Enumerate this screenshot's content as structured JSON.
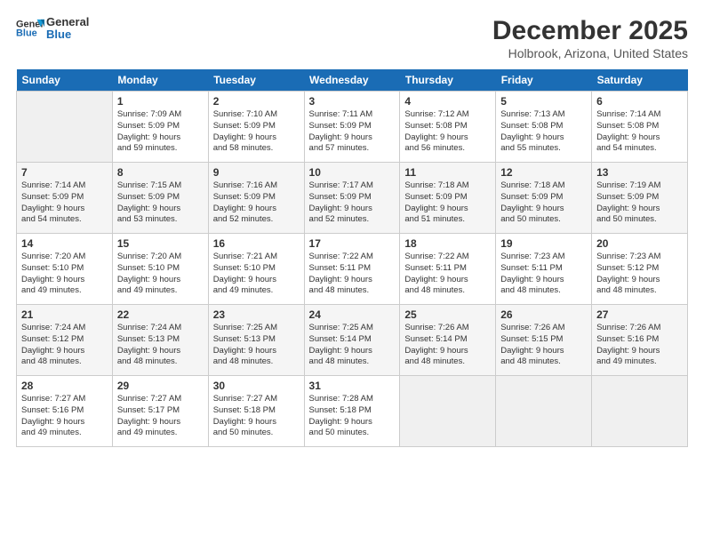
{
  "logo": {
    "line1": "General",
    "line2": "Blue"
  },
  "title": "December 2025",
  "subtitle": "Holbrook, Arizona, United States",
  "days": [
    "Sunday",
    "Monday",
    "Tuesday",
    "Wednesday",
    "Thursday",
    "Friday",
    "Saturday"
  ],
  "weeks": [
    [
      {
        "date": "",
        "info": ""
      },
      {
        "date": "1",
        "info": "Sunrise: 7:09 AM\nSunset: 5:09 PM\nDaylight: 9 hours\nand 59 minutes."
      },
      {
        "date": "2",
        "info": "Sunrise: 7:10 AM\nSunset: 5:09 PM\nDaylight: 9 hours\nand 58 minutes."
      },
      {
        "date": "3",
        "info": "Sunrise: 7:11 AM\nSunset: 5:09 PM\nDaylight: 9 hours\nand 57 minutes."
      },
      {
        "date": "4",
        "info": "Sunrise: 7:12 AM\nSunset: 5:08 PM\nDaylight: 9 hours\nand 56 minutes."
      },
      {
        "date": "5",
        "info": "Sunrise: 7:13 AM\nSunset: 5:08 PM\nDaylight: 9 hours\nand 55 minutes."
      },
      {
        "date": "6",
        "info": "Sunrise: 7:14 AM\nSunset: 5:08 PM\nDaylight: 9 hours\nand 54 minutes."
      }
    ],
    [
      {
        "date": "7",
        "info": "Sunrise: 7:14 AM\nSunset: 5:09 PM\nDaylight: 9 hours\nand 54 minutes."
      },
      {
        "date": "8",
        "info": "Sunrise: 7:15 AM\nSunset: 5:09 PM\nDaylight: 9 hours\nand 53 minutes."
      },
      {
        "date": "9",
        "info": "Sunrise: 7:16 AM\nSunset: 5:09 PM\nDaylight: 9 hours\nand 52 minutes."
      },
      {
        "date": "10",
        "info": "Sunrise: 7:17 AM\nSunset: 5:09 PM\nDaylight: 9 hours\nand 52 minutes."
      },
      {
        "date": "11",
        "info": "Sunrise: 7:18 AM\nSunset: 5:09 PM\nDaylight: 9 hours\nand 51 minutes."
      },
      {
        "date": "12",
        "info": "Sunrise: 7:18 AM\nSunset: 5:09 PM\nDaylight: 9 hours\nand 50 minutes."
      },
      {
        "date": "13",
        "info": "Sunrise: 7:19 AM\nSunset: 5:09 PM\nDaylight: 9 hours\nand 50 minutes."
      }
    ],
    [
      {
        "date": "14",
        "info": "Sunrise: 7:20 AM\nSunset: 5:10 PM\nDaylight: 9 hours\nand 49 minutes."
      },
      {
        "date": "15",
        "info": "Sunrise: 7:20 AM\nSunset: 5:10 PM\nDaylight: 9 hours\nand 49 minutes."
      },
      {
        "date": "16",
        "info": "Sunrise: 7:21 AM\nSunset: 5:10 PM\nDaylight: 9 hours\nand 49 minutes."
      },
      {
        "date": "17",
        "info": "Sunrise: 7:22 AM\nSunset: 5:11 PM\nDaylight: 9 hours\nand 48 minutes."
      },
      {
        "date": "18",
        "info": "Sunrise: 7:22 AM\nSunset: 5:11 PM\nDaylight: 9 hours\nand 48 minutes."
      },
      {
        "date": "19",
        "info": "Sunrise: 7:23 AM\nSunset: 5:11 PM\nDaylight: 9 hours\nand 48 minutes."
      },
      {
        "date": "20",
        "info": "Sunrise: 7:23 AM\nSunset: 5:12 PM\nDaylight: 9 hours\nand 48 minutes."
      }
    ],
    [
      {
        "date": "21",
        "info": "Sunrise: 7:24 AM\nSunset: 5:12 PM\nDaylight: 9 hours\nand 48 minutes."
      },
      {
        "date": "22",
        "info": "Sunrise: 7:24 AM\nSunset: 5:13 PM\nDaylight: 9 hours\nand 48 minutes."
      },
      {
        "date": "23",
        "info": "Sunrise: 7:25 AM\nSunset: 5:13 PM\nDaylight: 9 hours\nand 48 minutes."
      },
      {
        "date": "24",
        "info": "Sunrise: 7:25 AM\nSunset: 5:14 PM\nDaylight: 9 hours\nand 48 minutes."
      },
      {
        "date": "25",
        "info": "Sunrise: 7:26 AM\nSunset: 5:14 PM\nDaylight: 9 hours\nand 48 minutes."
      },
      {
        "date": "26",
        "info": "Sunrise: 7:26 AM\nSunset: 5:15 PM\nDaylight: 9 hours\nand 48 minutes."
      },
      {
        "date": "27",
        "info": "Sunrise: 7:26 AM\nSunset: 5:16 PM\nDaylight: 9 hours\nand 49 minutes."
      }
    ],
    [
      {
        "date": "28",
        "info": "Sunrise: 7:27 AM\nSunset: 5:16 PM\nDaylight: 9 hours\nand 49 minutes."
      },
      {
        "date": "29",
        "info": "Sunrise: 7:27 AM\nSunset: 5:17 PM\nDaylight: 9 hours\nand 49 minutes."
      },
      {
        "date": "30",
        "info": "Sunrise: 7:27 AM\nSunset: 5:18 PM\nDaylight: 9 hours\nand 50 minutes."
      },
      {
        "date": "31",
        "info": "Sunrise: 7:28 AM\nSunset: 5:18 PM\nDaylight: 9 hours\nand 50 minutes."
      },
      {
        "date": "",
        "info": ""
      },
      {
        "date": "",
        "info": ""
      },
      {
        "date": "",
        "info": ""
      }
    ]
  ]
}
